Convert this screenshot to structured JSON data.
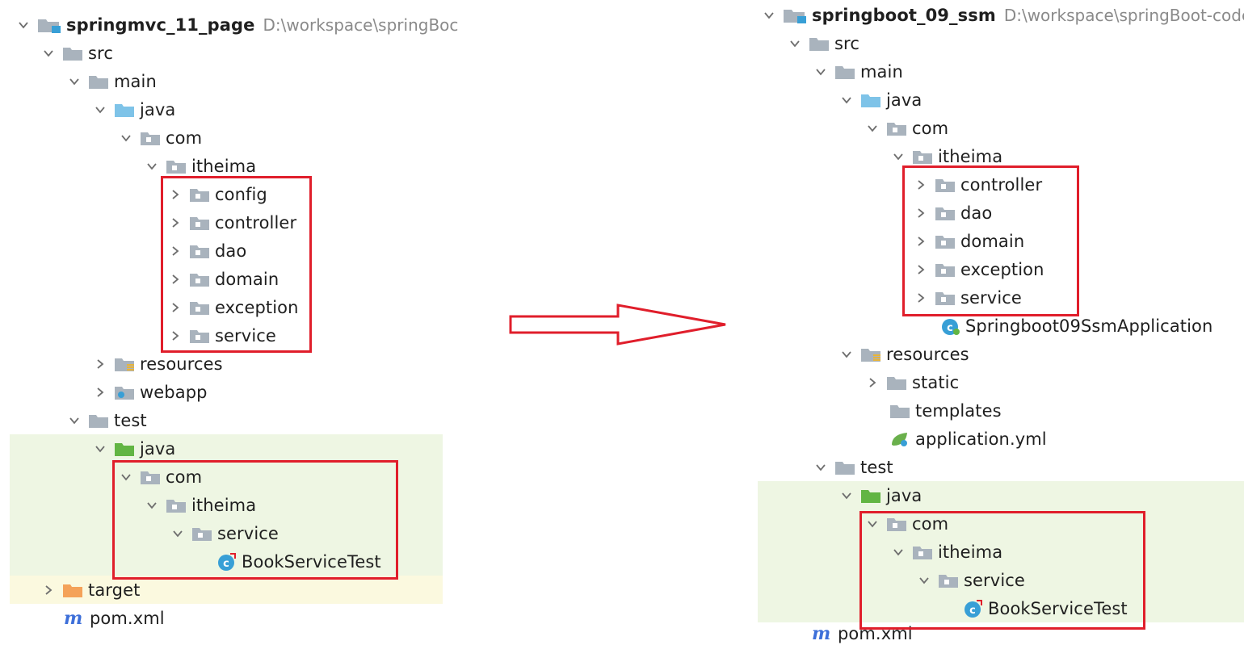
{
  "left_tree": {
    "project_name": "springmvc_11_page",
    "project_path": "D:\\workspace\\springBoc",
    "src": "src",
    "main": "main",
    "java": "java",
    "com": "com",
    "itheima": "itheima",
    "packages": [
      "config",
      "controller",
      "dao",
      "domain",
      "exception",
      "service"
    ],
    "resources": "resources",
    "webapp": "webapp",
    "test": "test",
    "test_java": "java",
    "test_com": "com",
    "test_itheima": "itheima",
    "test_service": "service",
    "test_class": "BookServiceTest",
    "target": "target",
    "pom": "pom.xml"
  },
  "right_tree": {
    "project_name": "springboot_09_ssm",
    "project_path": "D:\\workspace\\springBoot-code",
    "src": "src",
    "main": "main",
    "java": "java",
    "com": "com",
    "itheima": "itheima",
    "packages": [
      "controller",
      "dao",
      "domain",
      "exception",
      "service"
    ],
    "app_class": "Springboot09SsmApplication",
    "resources": "resources",
    "static": "static",
    "templates": "templates",
    "application_yml": "application.yml",
    "test": "test",
    "test_java": "java",
    "test_com": "com",
    "test_itheima": "itheima",
    "test_service": "service",
    "test_class": "BookServiceTest",
    "pom": "pom.xml"
  },
  "colors": {
    "highlight_border": "#e01e2b",
    "test_background": "#eef6e3",
    "target_background": "#fbf9df",
    "folder_gray": "#a9b3bd",
    "source_folder_blue": "#7ec3e8",
    "test_folder_green": "#62b543",
    "target_folder_orange": "#f4a259"
  }
}
